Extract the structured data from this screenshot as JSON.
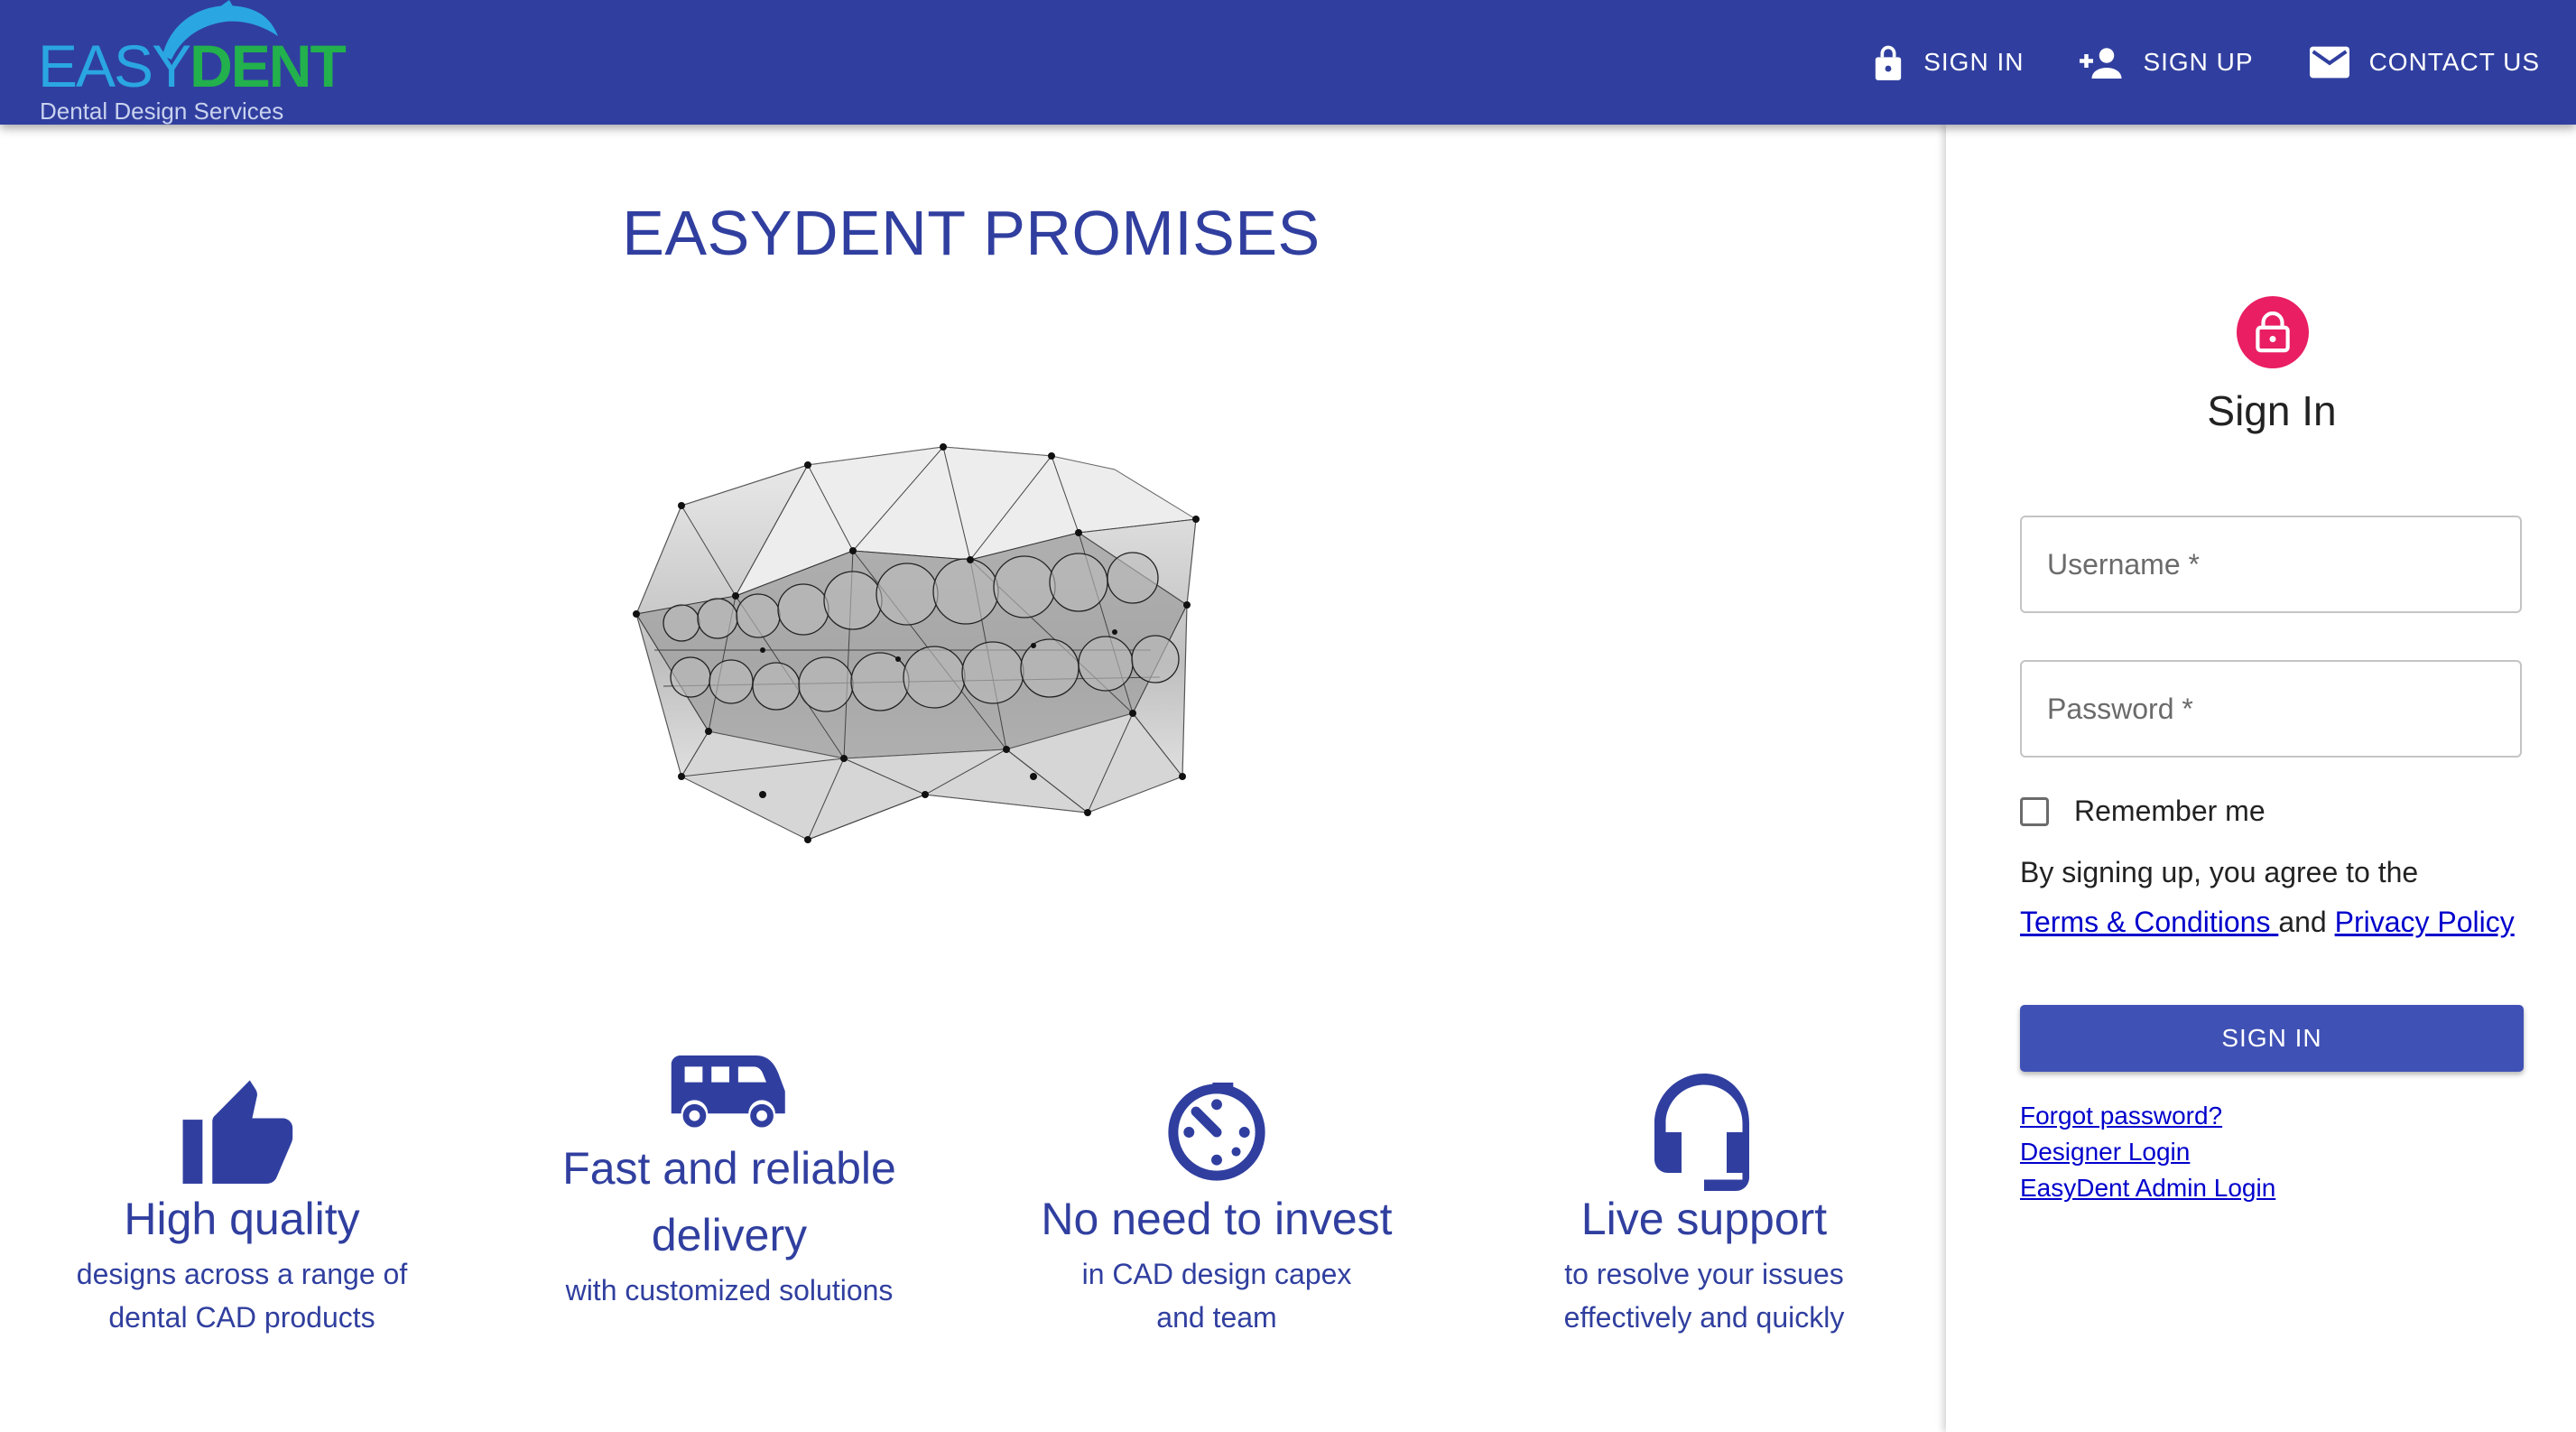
{
  "brand": {
    "logo_easy": "EASY",
    "logo_dent": "DENT",
    "logo_sub": "Dental Design Services"
  },
  "nav": [
    {
      "label": "SIGN IN",
      "icon": "lock-icon"
    },
    {
      "label": "SIGN UP",
      "icon": "person-add-icon"
    },
    {
      "label": "CONTACT US",
      "icon": "mail-icon"
    }
  ],
  "main": {
    "title": "EASYDENT PROMISES",
    "features": [
      {
        "icon": "thumbs-up-icon",
        "title": "High quality",
        "desc1": "designs across a range of",
        "desc2": "dental CAD products"
      },
      {
        "icon": "van-icon",
        "title1": "Fast and reliable",
        "title2": "delivery",
        "desc1": "with customized solutions"
      },
      {
        "icon": "timer-off-icon",
        "title": "No need to invest",
        "desc1": "in CAD design capex",
        "desc2": "and team"
      },
      {
        "icon": "headset-icon",
        "title": "Live support",
        "desc1": "to resolve your issues",
        "desc2": "effectively and quickly"
      }
    ]
  },
  "signin": {
    "title": "Sign In",
    "username_placeholder": "Username *",
    "password_placeholder": "Password *",
    "remember_label": "Remember me",
    "agree_text": "By signing up, you agree to the",
    "terms_link": "Terms & Conditions ",
    "and_text": "and ",
    "privacy_link": "Privacy Policy",
    "button_label": "SIGN IN",
    "forgot_link": "Forgot password?",
    "designer_link": "Designer Login",
    "admin_link": "EasyDent Admin Login"
  },
  "colors": {
    "appbar": "#303f9f",
    "primary_text": "#303f9f",
    "avatar": "#e91e63",
    "button": "#3f51b5"
  }
}
